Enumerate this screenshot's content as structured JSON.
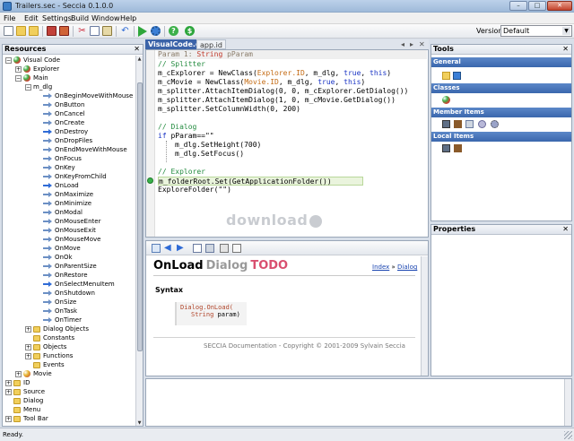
{
  "window": {
    "title": "Trailers.sec - Seccia 0.1.0.0",
    "min": "–",
    "max": "□",
    "close": "✕"
  },
  "menu": [
    "File",
    "Edit",
    "Settings",
    "Build",
    "Window",
    "Help"
  ],
  "toolbar": {
    "version_label": "Version",
    "version_value": "Default"
  },
  "resources": {
    "title": "Resources",
    "close": "✕",
    "tree": [
      {
        "label": "Visual Code",
        "depth": 0,
        "toggle": "−",
        "icon": "sphere"
      },
      {
        "label": "Explorer",
        "depth": 1,
        "toggle": "+",
        "icon": "sphere"
      },
      {
        "label": "Main",
        "depth": 1,
        "toggle": "−",
        "icon": "sphere"
      },
      {
        "label": "m_dlg",
        "depth": 2,
        "toggle": "−",
        "icon": "doc"
      },
      {
        "label": "OnBeginMoveWithMouse",
        "depth": 3,
        "icon": "evt"
      },
      {
        "label": "OnButton",
        "depth": 3,
        "icon": "evt"
      },
      {
        "label": "OnCancel",
        "depth": 3,
        "icon": "evt"
      },
      {
        "label": "OnCreate",
        "depth": 3,
        "icon": "evt"
      },
      {
        "label": "OnDestroy",
        "depth": 3,
        "icon": "evt-blue"
      },
      {
        "label": "OnDropFiles",
        "depth": 3,
        "icon": "evt"
      },
      {
        "label": "OnEndMoveWithMouse",
        "depth": 3,
        "icon": "evt"
      },
      {
        "label": "OnFocus",
        "depth": 3,
        "icon": "evt"
      },
      {
        "label": "OnKey",
        "depth": 3,
        "icon": "evt"
      },
      {
        "label": "OnKeyFromChild",
        "depth": 3,
        "icon": "evt"
      },
      {
        "label": "OnLoad",
        "depth": 3,
        "icon": "evt-blue"
      },
      {
        "label": "OnMaximize",
        "depth": 3,
        "icon": "evt"
      },
      {
        "label": "OnMinimize",
        "depth": 3,
        "icon": "evt"
      },
      {
        "label": "OnModal",
        "depth": 3,
        "icon": "evt"
      },
      {
        "label": "OnMouseEnter",
        "depth": 3,
        "icon": "evt"
      },
      {
        "label": "OnMouseExit",
        "depth": 3,
        "icon": "evt"
      },
      {
        "label": "OnMouseMove",
        "depth": 3,
        "icon": "evt"
      },
      {
        "label": "OnMove",
        "depth": 3,
        "icon": "evt"
      },
      {
        "label": "OnOk",
        "depth": 3,
        "icon": "evt"
      },
      {
        "label": "OnParentSize",
        "depth": 3,
        "icon": "evt"
      },
      {
        "label": "OnRestore",
        "depth": 3,
        "icon": "evt"
      },
      {
        "label": "OnSelectMenuItem",
        "depth": 3,
        "icon": "evt-blue"
      },
      {
        "label": "OnShutdown",
        "depth": 3,
        "icon": "evt"
      },
      {
        "label": "OnSize",
        "depth": 3,
        "icon": "evt"
      },
      {
        "label": "OnTask",
        "depth": 3,
        "icon": "evt"
      },
      {
        "label": "OnTimer",
        "depth": 3,
        "icon": "evt"
      },
      {
        "label": "Dialog Objects",
        "depth": 2,
        "toggle": "+",
        "icon": "folder"
      },
      {
        "label": "Constants",
        "depth": 2,
        "icon": "folder"
      },
      {
        "label": "Objects",
        "depth": 2,
        "toggle": "+",
        "icon": "folder"
      },
      {
        "label": "Functions",
        "depth": 2,
        "toggle": "+",
        "icon": "folder"
      },
      {
        "label": "Events",
        "depth": 2,
        "icon": "folder"
      },
      {
        "label": "Movie",
        "depth": 1,
        "toggle": "+",
        "icon": "movie"
      },
      {
        "label": "ID",
        "depth": 0,
        "toggle": "+",
        "icon": "folder"
      },
      {
        "label": "Source",
        "depth": 0,
        "toggle": "+",
        "icon": "folder"
      },
      {
        "label": "Dialog",
        "depth": 0,
        "icon": "folder"
      },
      {
        "label": "Menu",
        "depth": 0,
        "icon": "folder"
      },
      {
        "label": "Tool Bar",
        "depth": 0,
        "toggle": "+",
        "icon": "folder"
      }
    ]
  },
  "editor": {
    "tabs": [
      "VisualCode.gen",
      "app.id"
    ],
    "tab_controls": [
      "◂",
      "▸",
      "✕"
    ],
    "param_label": "Param 1:",
    "param_type": "String",
    "param_name": "pParam",
    "code": {
      "c1": "// Splitter",
      "l2a": "m_cExplorer = NewClass(",
      "l2b": "Explorer.ID",
      "l2c": ", m_dlg, ",
      "l2d": "true",
      "l2e": ", ",
      "l2f": "this",
      "l2g": ")",
      "l3a": "m_cMovie = NewClass(",
      "l3b": "Movie.ID",
      "l3c": ", m_dlg, ",
      "l3d": "true",
      "l3e": ", ",
      "l3f": "this",
      "l3g": ")",
      "l4": "m_splitter.AttachItemDialog(0, 0, m_cExplorer.GetDialog())",
      "l5": "m_splitter.AttachItemDialog(1, 0, m_cMovie.GetDialog())",
      "l6": "m_splitter.SetColumnWidth(0, 200)",
      "c2": "// Dialog",
      "l8a": "if",
      "l8b": " pParam==\"\"",
      "l9": "m_dlg.SetHeight(700)",
      "l10": "m_dlg.SetFocus()",
      "c3": "// Explorer",
      "l12": "m_folderRoot.Set(GetApplicationFolder())",
      "l13": "ExploreFolder(\"\")"
    }
  },
  "watermark": "download",
  "doc": {
    "title1": "OnLoad",
    "title2": "Dialog",
    "title3": "TODO",
    "link_index": "Index",
    "link_sep": " » ",
    "link_dialog": "Dialog",
    "syntax_heading": "Syntax",
    "syntax_line1": "Dialog.OnLoad(",
    "syntax_type": "String",
    "syntax_param": " param)",
    "footer": "SECCIA Documentation - Copyright © 2001-2009 Sylvain Seccia"
  },
  "tools": {
    "title": "Tools",
    "close": "✕",
    "sections": [
      "General",
      "Classes",
      "Member Items",
      "Local Items"
    ]
  },
  "properties": {
    "title": "Properties",
    "close": "✕"
  },
  "status": {
    "text": "Ready."
  },
  "colors": {
    "accent": "#3b63a8",
    "comment": "#238b3f",
    "keyword": "#1a34c4",
    "class": "#c46b14"
  }
}
